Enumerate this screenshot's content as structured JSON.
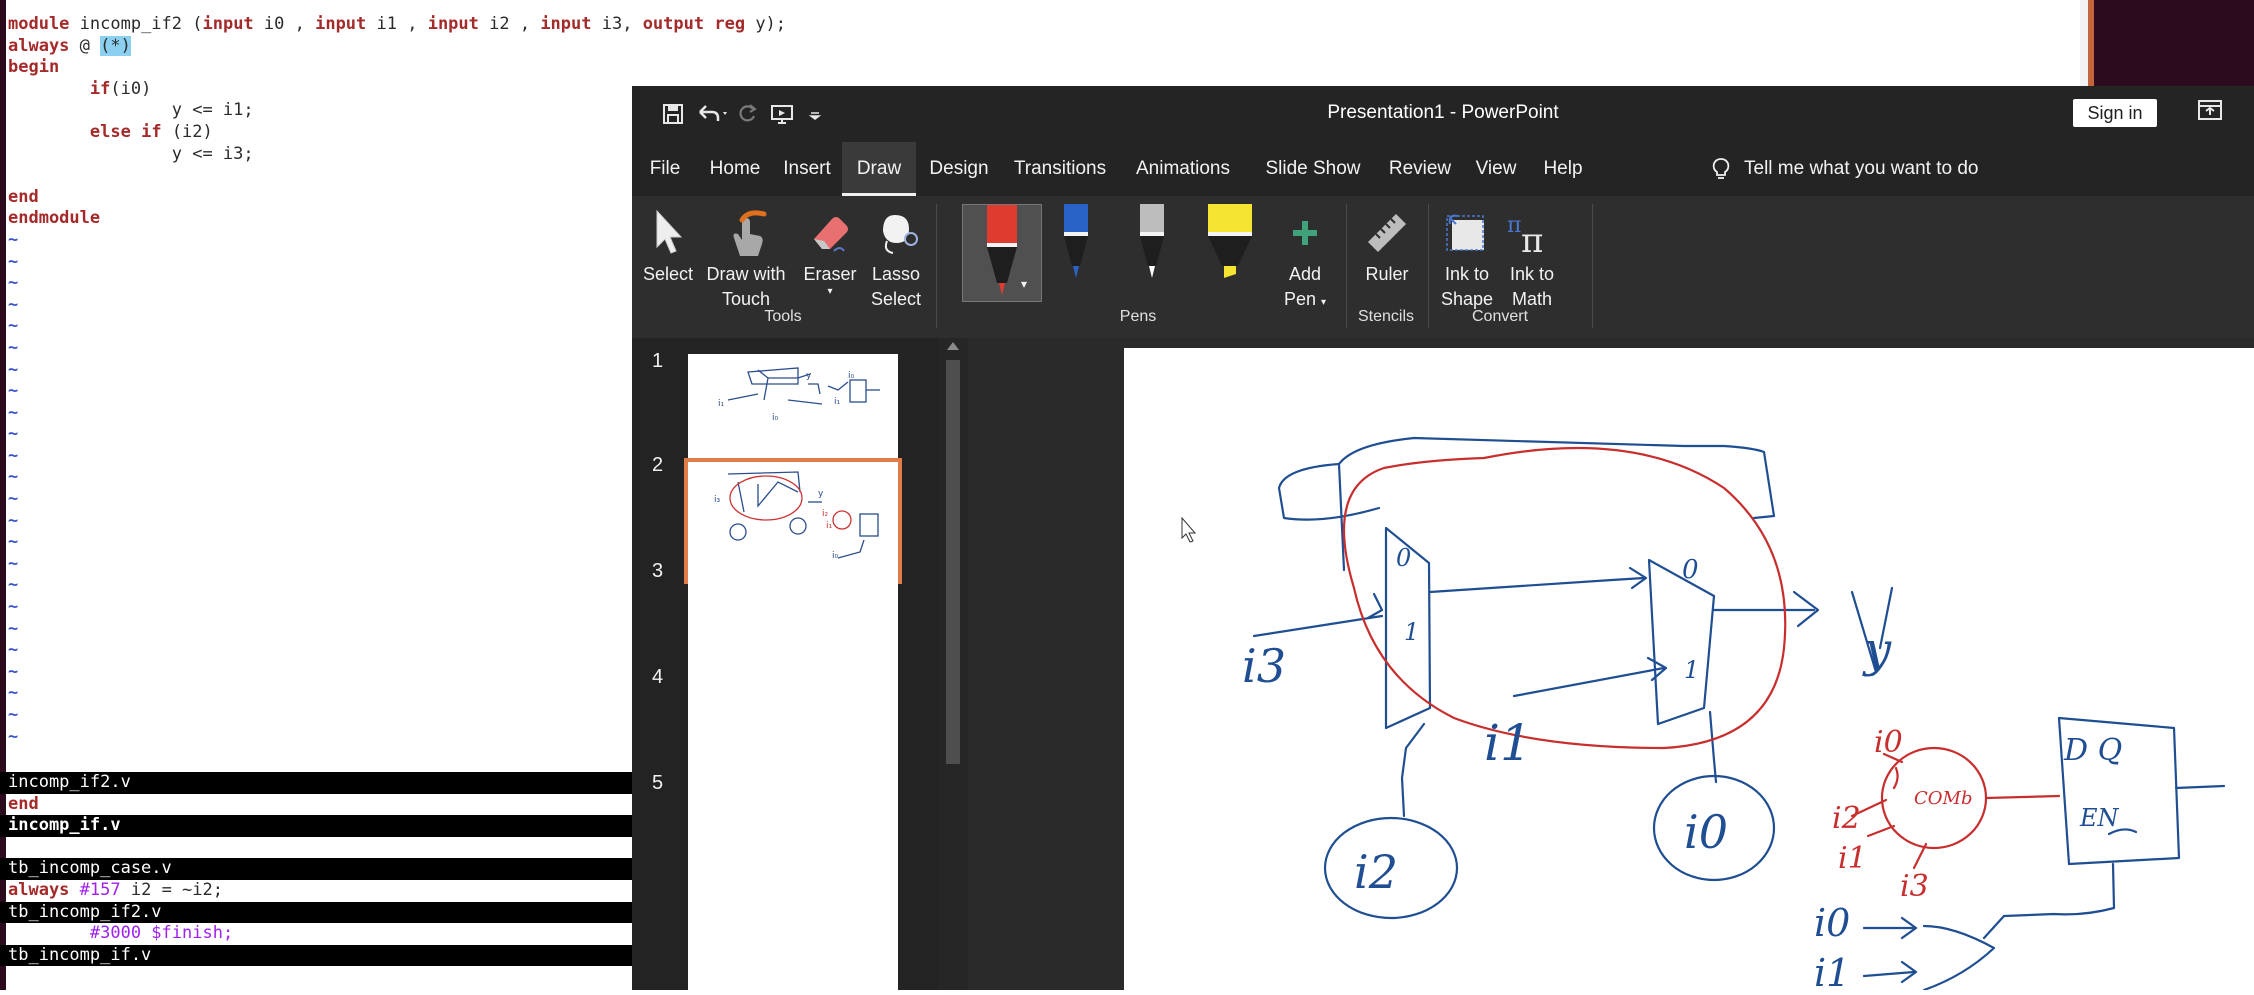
{
  "editor": {
    "code_lines": [
      "module incomp_if2 (input i0 , input i1 , input i2 , input i3, output reg y);",
      "always @ (*)",
      "begin",
      "        if(i0)",
      "                y <= i1;",
      "        else if (i2)",
      "                y <= i3;",
      "",
      "end",
      "endmodule"
    ],
    "files": [
      {
        "text": "incomp_if2.v",
        "style": "bar"
      },
      {
        "text": "end",
        "style": "plain"
      },
      {
        "text": "incomp_if.v",
        "style": "bar-bold"
      },
      {
        "text": "",
        "style": "plain"
      },
      {
        "text": "tb_incomp_case.v",
        "style": "bar"
      },
      {
        "text": "always #157 i2 = ~i2;",
        "style": "plain"
      },
      {
        "text": "tb_incomp_if2.v",
        "style": "bar"
      },
      {
        "text": "        #3000 $finish;",
        "style": "plain"
      },
      {
        "text": "tb_incomp_if.v",
        "style": "bar"
      }
    ]
  },
  "ppt": {
    "title": "Presentation1  -  PowerPoint",
    "sign_in": "Sign in",
    "tabs": [
      "File",
      "Home",
      "Insert",
      "Draw",
      "Design",
      "Transitions",
      "Animations",
      "Slide Show",
      "Review",
      "View",
      "Help"
    ],
    "active_tab": "Draw",
    "tell_me": "Tell me what you want to do",
    "ribbon": {
      "select": "Select",
      "draw_touch": [
        "Draw with",
        "Touch"
      ],
      "eraser": "Eraser",
      "lasso": [
        "Lasso",
        "Select"
      ],
      "add_pen": [
        "Add",
        "Pen"
      ],
      "ruler": "Ruler",
      "ink_shape": [
        "Ink to",
        "Shape"
      ],
      "ink_math": [
        "Ink to",
        "Math"
      ],
      "groups": {
        "tools": "Tools",
        "pens": "Pens",
        "stencils": "Stencils",
        "convert": "Convert"
      }
    },
    "pens": [
      {
        "name": "red-pen",
        "color": "#e03b2f"
      },
      {
        "name": "blue-pen",
        "color": "#2a63c8"
      },
      {
        "name": "gray-pencil",
        "color": "#bdbdbd"
      },
      {
        "name": "yellow-highlighter",
        "color": "#f5e431"
      }
    ],
    "slide_numbers": [
      "1",
      "2",
      "3",
      "4",
      "5"
    ],
    "selected_slide": "2",
    "sketch_labels": {
      "y": "y",
      "i3": "i3",
      "i1": "i1",
      "i2": "i2",
      "i0": "i0",
      "zero": "0",
      "one": "1",
      "i0r": "i0",
      "i2r": "i2",
      "i1r": "i1",
      "i3r": "i3",
      "comb": "COMb",
      "dq": "D  Q",
      "en": "EN",
      "i0b": "i0",
      "i1b": "i1"
    }
  }
}
